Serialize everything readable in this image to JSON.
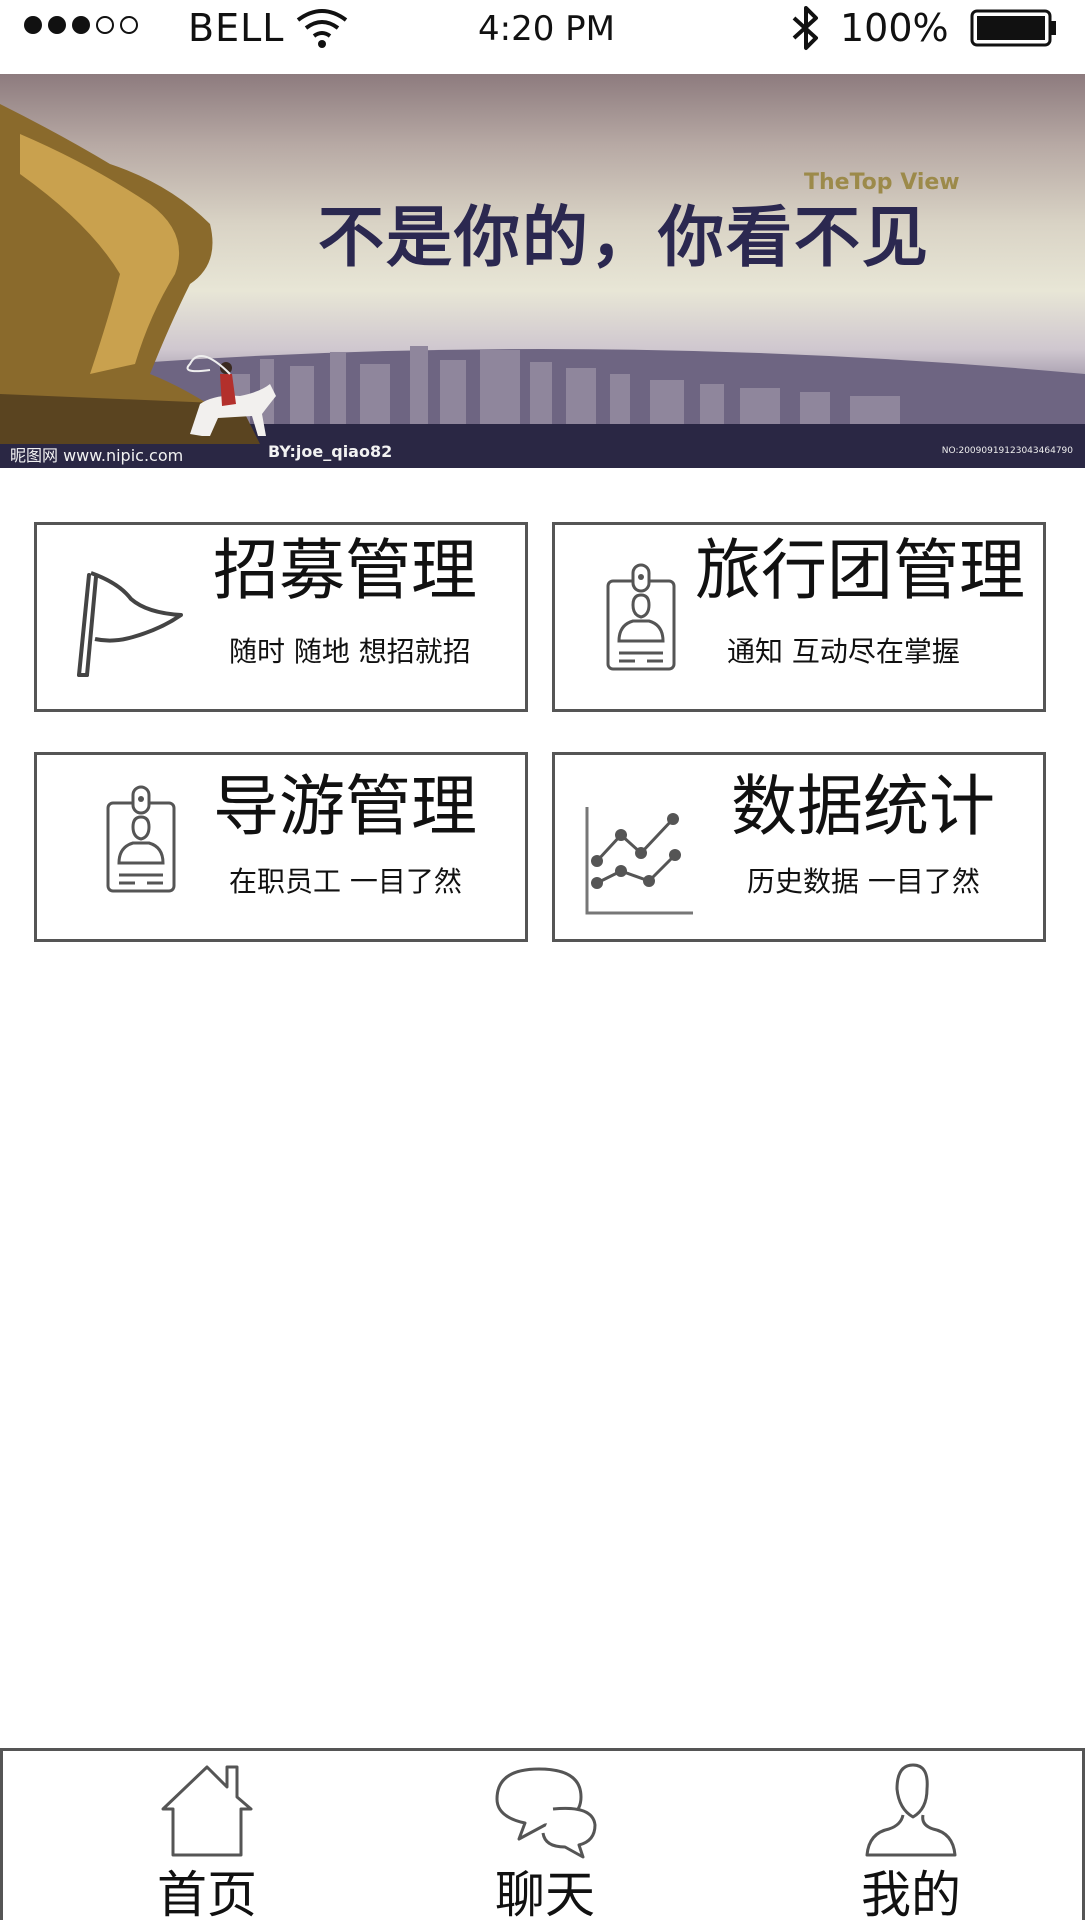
{
  "status_bar": {
    "carrier": "BELL",
    "time": "4:20 PM",
    "battery": "100%",
    "signal_strength": "3 of 5",
    "icons": [
      "wifi-icon",
      "bluetooth-icon",
      "battery-icon"
    ]
  },
  "banner": {
    "title": "不是你的，你看不见",
    "tagline": "TheTop View",
    "credit": "昵图网 www.nipic.com",
    "credit_by": "BY:joe_qiao82",
    "number": "NO:20090919123043464790"
  },
  "cards": [
    {
      "title": "招募管理",
      "subtitle": "随时 随地 想招就招",
      "icon": "flag-icon"
    },
    {
      "title": "旅行团管理",
      "subtitle": "通知 互动尽在掌握",
      "icon": "id-badge-icon"
    },
    {
      "title": "导游管理",
      "subtitle": "在职员工 一目了然",
      "icon": "id-badge-icon"
    },
    {
      "title": "数据统计",
      "subtitle": "历史数据 一目了然",
      "icon": "line-chart-icon"
    }
  ],
  "bottom_nav": {
    "items": [
      {
        "label": "首页",
        "icon": "home-icon"
      },
      {
        "label": "聊天",
        "icon": "chat-icon"
      },
      {
        "label": "我的",
        "icon": "user-icon"
      }
    ]
  },
  "colors": {
    "border": "#555555",
    "text": "#111111",
    "banner_title": "#2b2850",
    "banner_tag": "#9c8a4a"
  }
}
